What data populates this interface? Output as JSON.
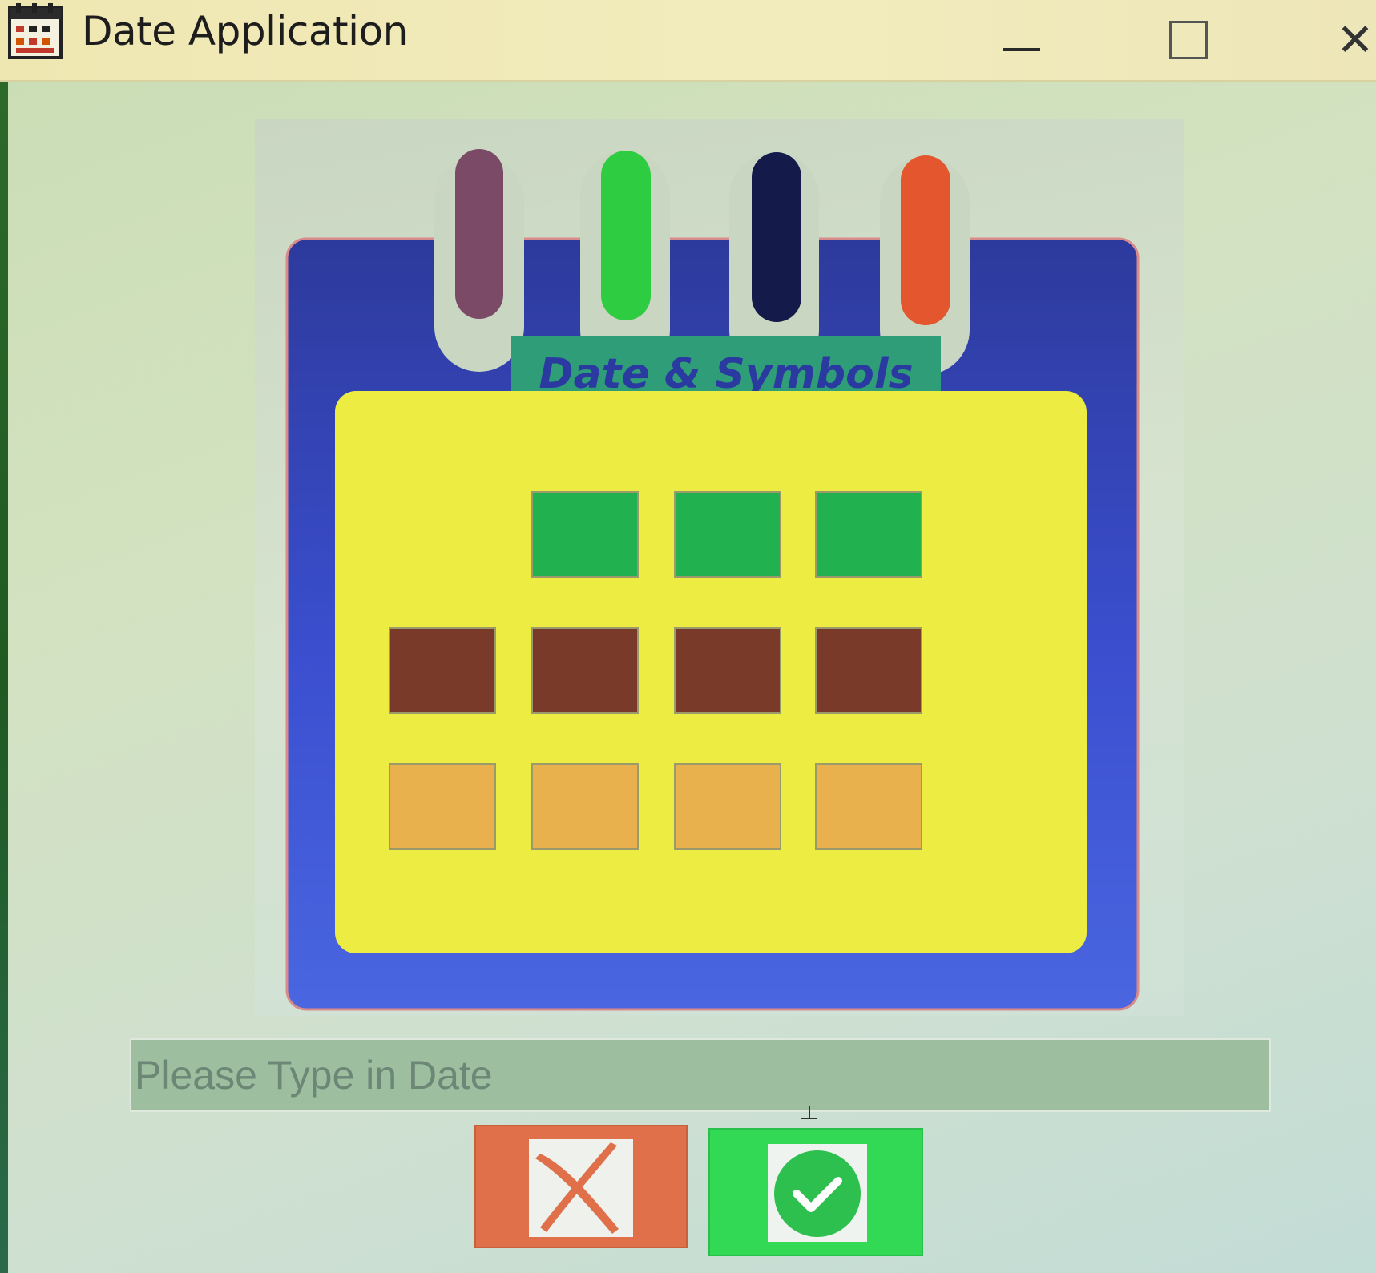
{
  "window": {
    "title": "Date Application",
    "icon": "calendar-app-icon",
    "controls": {
      "minimize_icon": "minimize-icon",
      "maximize_icon": "maximize-icon",
      "close_glyph": "✕"
    }
  },
  "banner": {
    "caption": "Date & Symbols",
    "ring_colors": [
      "#7a4a66",
      "#2ecc40",
      "#141a4a",
      "#e4572e"
    ],
    "colors": {
      "frame": "#3c4fd1",
      "page": "#ecec42",
      "caption_bg": "#2f9e78",
      "caption_text": "#2a3aa0"
    },
    "grid": {
      "rows": [
        {
          "color": "#21b24f",
          "cells": [
            false,
            true,
            true,
            true
          ]
        },
        {
          "color": "#7a3a2a",
          "cells": [
            true,
            true,
            true,
            true
          ]
        },
        {
          "color": "#e8b14e",
          "cells": [
            true,
            true,
            true,
            true
          ]
        }
      ]
    }
  },
  "date_input": {
    "placeholder": "Please Type in Date",
    "value": ""
  },
  "actions": {
    "cancel_icon": "x-mark-icon",
    "cancel_color": "#e07049",
    "confirm_icon": "checkmark-circle-icon",
    "confirm_color": "#32d955"
  }
}
